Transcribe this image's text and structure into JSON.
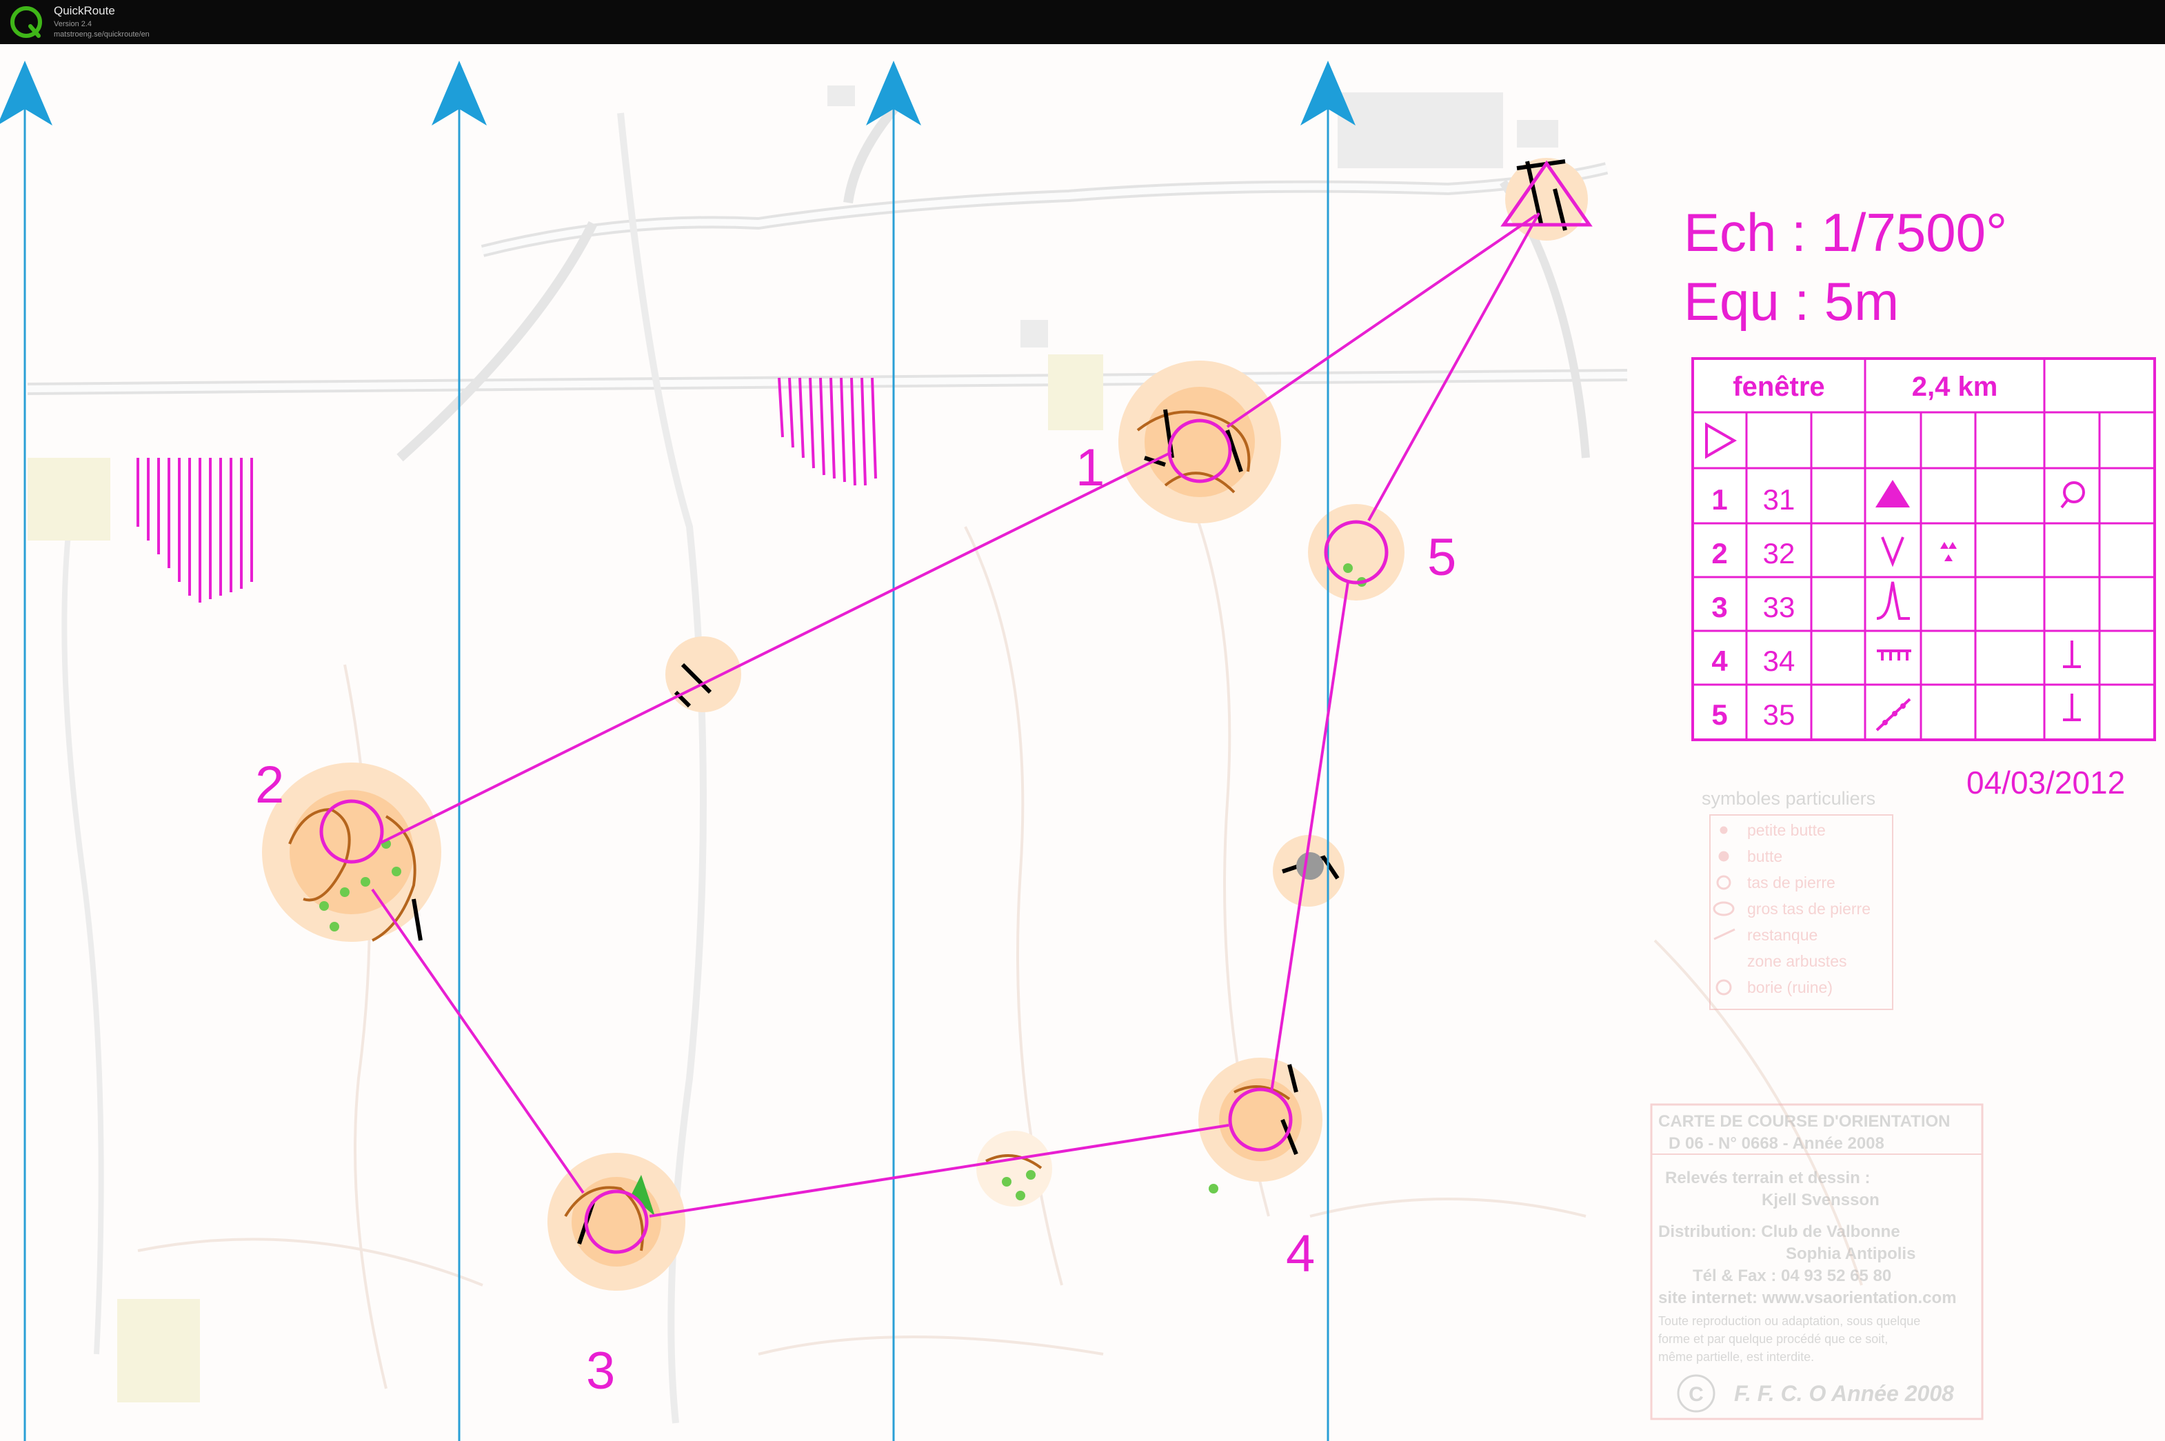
{
  "app": {
    "name": "QuickRoute",
    "version": "Version 2.4",
    "url": "matstroeng.se/quickroute/en"
  },
  "map": {
    "scale_label": "Ech : 1/7500°",
    "equidistance_label": "Equ : 5m",
    "date": "04/03/2012",
    "colors": {
      "course": "#e81fd2",
      "north_line": "#2a9fd6",
      "north_arrow": "#1e9ed9",
      "contour": "#c98a4a",
      "path": "#000000"
    },
    "controls": [
      {
        "number": "1",
        "code": "31"
      },
      {
        "number": "2",
        "code": "32"
      },
      {
        "number": "3",
        "code": "33"
      },
      {
        "number": "4",
        "code": "34"
      },
      {
        "number": "5",
        "code": "35"
      }
    ],
    "description_sheet": {
      "header_name": "fenêtre",
      "header_length": "2,4 km",
      "start_symbol": "start-triangle-icon",
      "rows": [
        {
          "number": "1",
          "code": "31",
          "feature": "boulder-icon",
          "detail": "",
          "appearance": "depression-icon"
        },
        {
          "number": "2",
          "code": "32",
          "feature": "re-entrant-icon",
          "detail": "stony-ground-icon",
          "appearance": ""
        },
        {
          "number": "3",
          "code": "33",
          "feature": "spur-icon",
          "detail": "",
          "appearance": ""
        },
        {
          "number": "4",
          "code": "34",
          "feature": "cliff-icon",
          "detail": "",
          "appearance": "foot-icon"
        },
        {
          "number": "5",
          "code": "35",
          "feature": "ruined-wall-icon",
          "detail": "",
          "appearance": "foot-icon"
        }
      ]
    },
    "special_symbols": {
      "title": "symboles particuliers",
      "items": [
        "petite butte",
        "butte",
        "tas de pierre",
        "gros tas de pierre",
        "restanque",
        "zone arbustes",
        "borie (ruine)"
      ]
    },
    "credits": {
      "lines": [
        "CARTE DE COURSE D'ORIENTATION",
        "D 06 - N° 0668 - Année 2008",
        "Relevés terrain  et dessin :",
        "Kjell Svensson",
        "Distribution:     Club de Valbonne",
        "Sophia Antipolis",
        "Tél & Fax : 04 93 52 65 80",
        "site internet: www.vsaorientation.com",
        "Toute reproduction ou adaptation, sous quelque",
        "forme et par quelque procédé  que ce soit,",
        "même partielle, est interdite.",
        "F. F. C. O Année 2008"
      ]
    }
  }
}
